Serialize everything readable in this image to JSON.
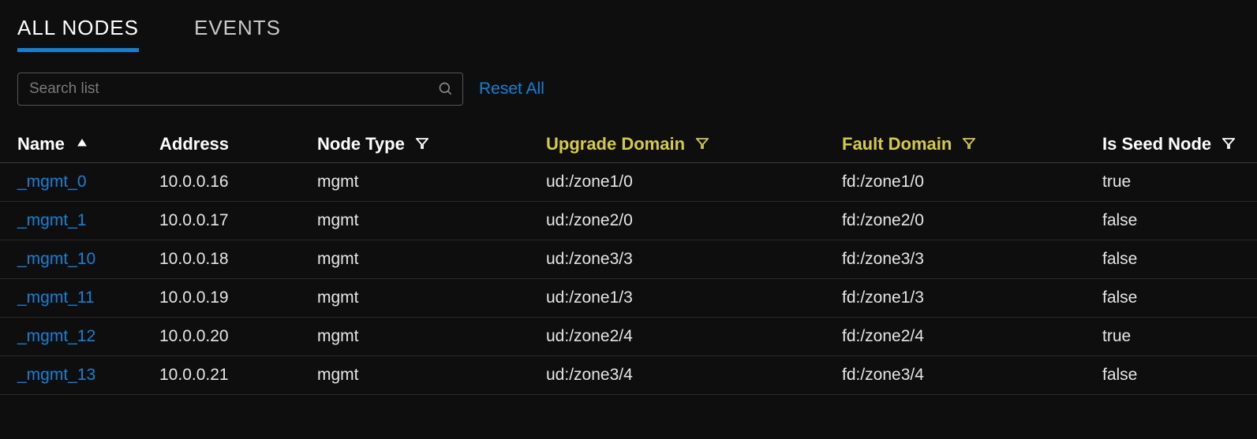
{
  "tabs": {
    "all_nodes": "ALL NODES",
    "events": "EVENTS"
  },
  "toolbar": {
    "search_placeholder": "Search list",
    "reset_label": "Reset All"
  },
  "table": {
    "headers": {
      "name": "Name",
      "address": "Address",
      "node_type": "Node Type",
      "upgrade_domain": "Upgrade Domain",
      "fault_domain": "Fault Domain",
      "is_seed": "Is Seed Node"
    },
    "rows": [
      {
        "name": "_mgmt_0",
        "address": "10.0.0.16",
        "node_type": "mgmt",
        "upgrade_domain": "ud:/zone1/0",
        "fault_domain": "fd:/zone1/0",
        "is_seed": "true"
      },
      {
        "name": "_mgmt_1",
        "address": "10.0.0.17",
        "node_type": "mgmt",
        "upgrade_domain": "ud:/zone2/0",
        "fault_domain": "fd:/zone2/0",
        "is_seed": "false"
      },
      {
        "name": "_mgmt_10",
        "address": "10.0.0.18",
        "node_type": "mgmt",
        "upgrade_domain": "ud:/zone3/3",
        "fault_domain": "fd:/zone3/3",
        "is_seed": "false"
      },
      {
        "name": "_mgmt_11",
        "address": "10.0.0.19",
        "node_type": "mgmt",
        "upgrade_domain": "ud:/zone1/3",
        "fault_domain": "fd:/zone1/3",
        "is_seed": "false"
      },
      {
        "name": "_mgmt_12",
        "address": "10.0.0.20",
        "node_type": "mgmt",
        "upgrade_domain": "ud:/zone2/4",
        "fault_domain": "fd:/zone2/4",
        "is_seed": "true"
      },
      {
        "name": "_mgmt_13",
        "address": "10.0.0.21",
        "node_type": "mgmt",
        "upgrade_domain": "ud:/zone3/4",
        "fault_domain": "fd:/zone3/4",
        "is_seed": "false"
      }
    ]
  }
}
